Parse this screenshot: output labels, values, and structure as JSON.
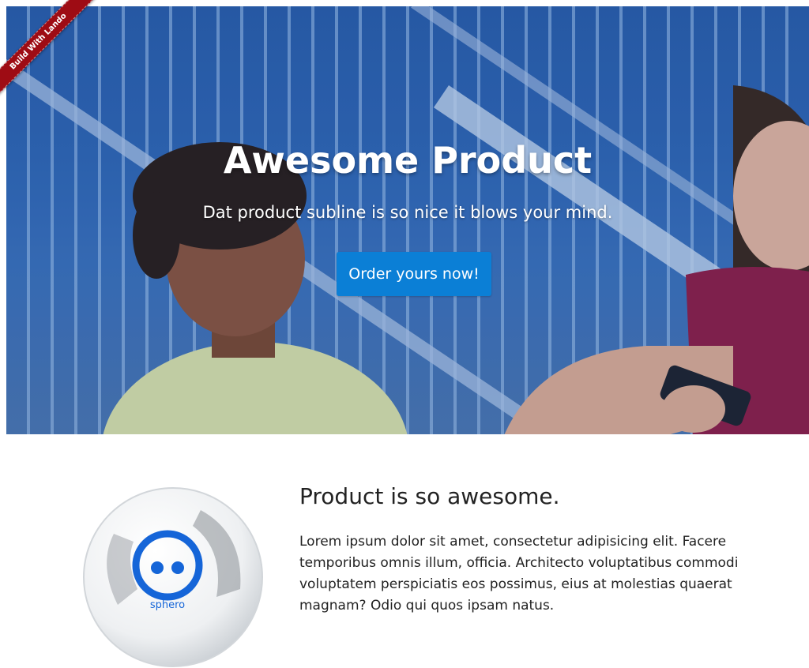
{
  "ribbon": {
    "label": "Build With Lando"
  },
  "hero": {
    "title": "Awesome Product",
    "subline": "Dat product subline is so nice it blows your mind.",
    "cta_label": "Order yours now!",
    "cta_color": "#0b7fd6"
  },
  "feature": {
    "image_label": "sphero",
    "title": "Product is so awesome.",
    "body": "Lorem ipsum dolor sit amet, consectetur adipisicing elit. Facere temporibus omnis illum, officia. Architecto voluptatibus commodi voluptatem perspiciatis eos possimus, eius at molestias quaerat magnam? Odio qui quos ipsam natus."
  },
  "colors": {
    "ribbon": "#9e0c14",
    "hero_blue": "#2f68b8"
  }
}
